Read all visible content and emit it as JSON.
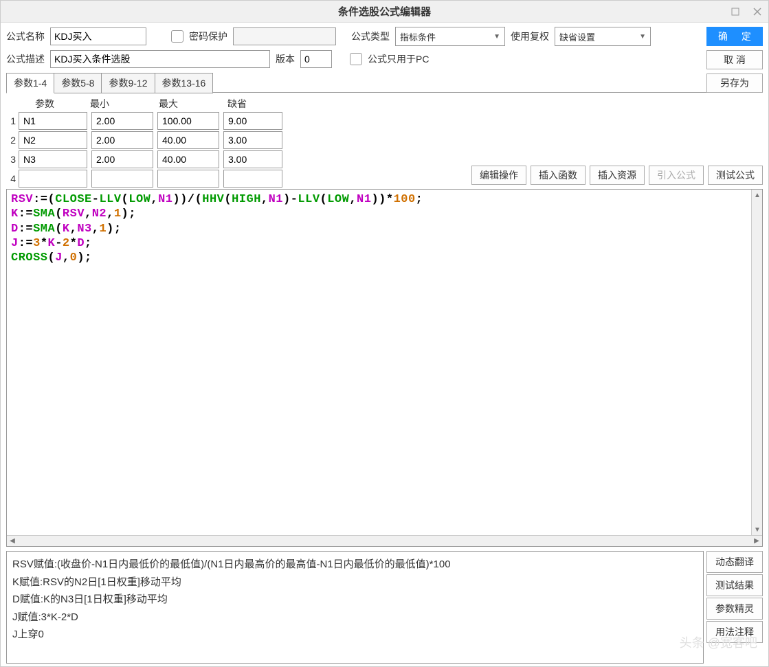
{
  "window": {
    "title": "条件选股公式编辑器"
  },
  "labels": {
    "formula_name": "公式名称",
    "password_protect": "密码保护",
    "formula_type": "公式类型",
    "use_adjust": "使用复权",
    "formula_desc": "公式描述",
    "version": "版本",
    "pc_only": "公式只用于PC"
  },
  "values": {
    "formula_name": "KDJ买入",
    "formula_type": "指标条件",
    "use_adjust": "缺省设置",
    "formula_desc": "KDJ买入条件选股",
    "version": "0"
  },
  "buttons": {
    "ok": "确 定",
    "cancel": "取 消",
    "save_as": "另存为",
    "edit_op": "编辑操作",
    "insert_func": "插入函数",
    "insert_res": "插入资源",
    "import_formula": "引入公式",
    "test_formula": "测试公式",
    "dyn_translate": "动态翻译",
    "test_result": "测试结果",
    "param_wizard": "参数精灵",
    "usage_note": "用法注释"
  },
  "tabs": [
    "参数1-4",
    "参数5-8",
    "参数9-12",
    "参数13-16"
  ],
  "param_headers": {
    "name": "参数",
    "min": "最小",
    "max": "最大",
    "default": "缺省"
  },
  "params": [
    {
      "idx": "1",
      "name": "N1",
      "min": "2.00",
      "max": "100.00",
      "default": "9.00"
    },
    {
      "idx": "2",
      "name": "N2",
      "min": "2.00",
      "max": "40.00",
      "default": "3.00"
    },
    {
      "idx": "3",
      "name": "N3",
      "min": "2.00",
      "max": "40.00",
      "default": "3.00"
    },
    {
      "idx": "4",
      "name": "",
      "min": "",
      "max": "",
      "default": ""
    }
  ],
  "code_tokens": [
    [
      {
        "t": "RSV",
        "c": "var"
      },
      {
        "t": ":=(",
        "c": "op"
      },
      {
        "t": "CLOSE",
        "c": "kw"
      },
      {
        "t": "-",
        "c": "op"
      },
      {
        "t": "LLV",
        "c": "kw"
      },
      {
        "t": "(",
        "c": "op"
      },
      {
        "t": "LOW",
        "c": "kw"
      },
      {
        "t": ",",
        "c": "op"
      },
      {
        "t": "N1",
        "c": "var"
      },
      {
        "t": "))/(",
        "c": "op"
      },
      {
        "t": "HHV",
        "c": "kw"
      },
      {
        "t": "(",
        "c": "op"
      },
      {
        "t": "HIGH",
        "c": "kw"
      },
      {
        "t": ",",
        "c": "op"
      },
      {
        "t": "N1",
        "c": "var"
      },
      {
        "t": ")-",
        "c": "op"
      },
      {
        "t": "LLV",
        "c": "kw"
      },
      {
        "t": "(",
        "c": "op"
      },
      {
        "t": "LOW",
        "c": "kw"
      },
      {
        "t": ",",
        "c": "op"
      },
      {
        "t": "N1",
        "c": "var"
      },
      {
        "t": "))*",
        "c": "op"
      },
      {
        "t": "100",
        "c": "num"
      },
      {
        "t": ";",
        "c": "op"
      }
    ],
    [
      {
        "t": "K",
        "c": "var"
      },
      {
        "t": ":=",
        "c": "op"
      },
      {
        "t": "SMA",
        "c": "kw"
      },
      {
        "t": "(",
        "c": "op"
      },
      {
        "t": "RSV",
        "c": "var"
      },
      {
        "t": ",",
        "c": "op"
      },
      {
        "t": "N2",
        "c": "var"
      },
      {
        "t": ",",
        "c": "op"
      },
      {
        "t": "1",
        "c": "num"
      },
      {
        "t": ");",
        "c": "op"
      }
    ],
    [
      {
        "t": "D",
        "c": "var"
      },
      {
        "t": ":=",
        "c": "op"
      },
      {
        "t": "SMA",
        "c": "kw"
      },
      {
        "t": "(",
        "c": "op"
      },
      {
        "t": "K",
        "c": "var"
      },
      {
        "t": ",",
        "c": "op"
      },
      {
        "t": "N3",
        "c": "var"
      },
      {
        "t": ",",
        "c": "op"
      },
      {
        "t": "1",
        "c": "num"
      },
      {
        "t": ");",
        "c": "op"
      }
    ],
    [
      {
        "t": "J",
        "c": "var"
      },
      {
        "t": ":=",
        "c": "op"
      },
      {
        "t": "3",
        "c": "num"
      },
      {
        "t": "*",
        "c": "op"
      },
      {
        "t": "K",
        "c": "var"
      },
      {
        "t": "-",
        "c": "op"
      },
      {
        "t": "2",
        "c": "num"
      },
      {
        "t": "*",
        "c": "op"
      },
      {
        "t": "D",
        "c": "var"
      },
      {
        "t": ";",
        "c": "op"
      }
    ],
    [
      {
        "t": "CROSS",
        "c": "kw"
      },
      {
        "t": "(",
        "c": "op"
      },
      {
        "t": "J",
        "c": "var"
      },
      {
        "t": ",",
        "c": "op"
      },
      {
        "t": "0",
        "c": "num"
      },
      {
        "t": ");",
        "c": "op"
      }
    ]
  ],
  "translation": [
    "RSV赋值:(收盘价-N1日内最低价的最低值)/(N1日内最高价的最高值-N1日内最低价的最低值)*100",
    "K赋值:RSV的N2日[1日权重]移动平均",
    "D赋值:K的N3日[1日权重]移动平均",
    "J赋值:3*K-2*D",
    "J上穿0"
  ],
  "watermark": "头条 @宽客吧"
}
